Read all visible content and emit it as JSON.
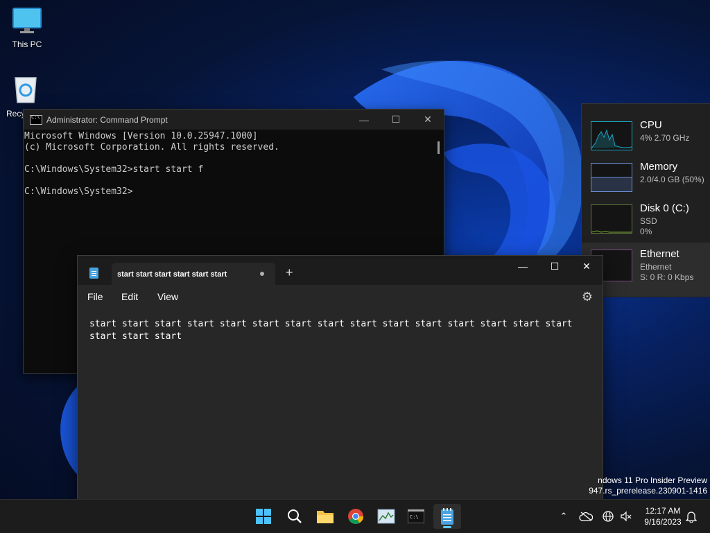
{
  "desktop": {
    "icons": [
      {
        "label": "This PC"
      },
      {
        "label": "Recy"
      }
    ]
  },
  "cmd": {
    "title": "Administrator: Command Prompt",
    "lines": [
      "Microsoft Windows [Version 10.0.25947.1000]",
      "(c) Microsoft Corporation. All rights reserved.",
      "",
      "C:\\Windows\\System32>start start f",
      "",
      "C:\\Windows\\System32>"
    ]
  },
  "perf": {
    "items": [
      {
        "name": "CPU",
        "line1": "4% 2.70 GHz",
        "line2": "",
        "color": "#1aa6c4"
      },
      {
        "name": "Memory",
        "line1": "2.0/4.0 GB (50%)",
        "line2": "",
        "color": "#6d8fd6"
      },
      {
        "name": "Disk 0 (C:)",
        "line1": "SSD",
        "line2": "0%",
        "color": "#7fb23a"
      },
      {
        "name": "Ethernet",
        "line1": "Ethernet",
        "line2": "S: 0 R: 0 Kbps",
        "color": "#a35fb0"
      }
    ]
  },
  "notepad": {
    "tab_title": "start start start start start start",
    "new_tab": "+",
    "menu": {
      "file": "File",
      "edit": "Edit",
      "view": "View"
    },
    "content": "start start start start start start start start start start start start start start start start start start"
  },
  "watermark": {
    "line1": "ndows 11 Pro Insider Preview",
    "line2": "947.rs_prerelease.230901-1416"
  },
  "taskbar": {
    "time": "12:17 AM",
    "date": "9/16/2023",
    "accent": "#60cdff"
  }
}
